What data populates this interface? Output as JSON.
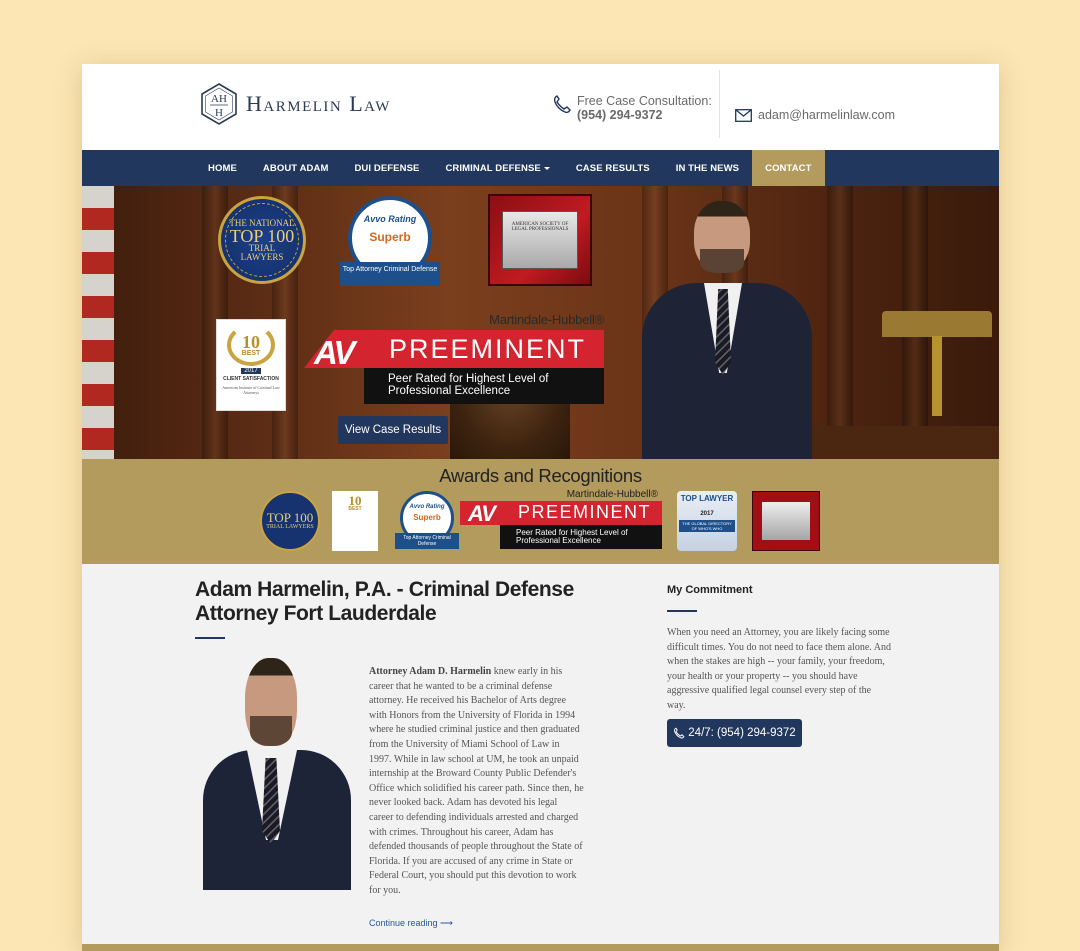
{
  "header": {
    "logo_text": "Harmelin Law",
    "logo_monogram": "AH",
    "consult_label": "Free Case Consultation:",
    "consult_phone": "(954) 294-9372",
    "email": "adam@harmelinlaw.com",
    "icons": [
      "phone-icon",
      "envelope-icon"
    ]
  },
  "nav": {
    "items": [
      {
        "label": "HOME"
      },
      {
        "label": "ABOUT ADAM"
      },
      {
        "label": "DUI DEFENSE"
      },
      {
        "label": "CRIMINAL DEFENSE"
      },
      {
        "label": "CASE RESULTS"
      },
      {
        "label": "IN THE NEWS"
      },
      {
        "label": "CONTACT"
      }
    ],
    "active": "CONTACT",
    "colors": {
      "bar": "#22375e",
      "active": "#b39a5d"
    }
  },
  "hero": {
    "top100": {
      "l1": "THE NATIONAL",
      "big": "TOP 100",
      "l2": "TRIAL",
      "l3": "LAWYERS"
    },
    "avvo": {
      "rating": "Avvo Rating",
      "grade": "Superb",
      "ribbon": "Top Attorney Criminal Defense"
    },
    "plaque": {
      "text": "AMERICAN SOCIETY OF LEGAL PROFESSIONALS"
    },
    "tenbest": {
      "num": "10",
      "best": "BEST",
      "year": "2017",
      "label": "CLIENT SATISFACTION",
      "org": "American Institute of Criminal Law Attorneys"
    },
    "av": {
      "brand": "Martindale-Hubbell®",
      "letters": "AV",
      "word": "PREEMINENT",
      "sub": "Peer Rated for Highest Level of Professional Excellence"
    },
    "button": "View Case Results"
  },
  "awards": {
    "title": "Awards and Recognitions",
    "top100": {
      "big": "TOP 100",
      "sm": "TRIAL LAWYERS"
    },
    "tenbest": {
      "num": "10",
      "best": "BEST"
    },
    "avvo": {
      "rating": "Avvo Rating",
      "grade": "Superb",
      "ribbon": "Top Attorney Criminal Defense"
    },
    "av": {
      "brand": "Martindale-Hubbell®",
      "letters": "AV",
      "word": "PREEMINENT",
      "sub": "Peer Rated for Highest Level of Professional Excellence"
    },
    "toplawyer": {
      "title": "TOP LAWYER",
      "year": "2017",
      "dir": "THE GLOBAL DIRECTORY OF WHO'S WHO"
    }
  },
  "content": {
    "title": "Adam Harmelin, P.A. - Criminal Defense Attorney Fort Lauderdale",
    "bio_lead": "Attorney Adam D. Harmelin",
    "bio": " knew early in his career that he wanted to be a criminal defense attorney. He received his Bachelor of Arts degree with Honors from the University of Florida in 1994 where he studied criminal justice and then graduated from the University of Miami School of Law in 1997. While in law school at UM, he took an unpaid internship at the Broward County Public Defender's Office which solidified his career path. Since then, he never looked back. Adam has devoted his legal career to defending individuals arrested and charged with crimes. Throughout his career, Adam has defended thousands of people throughout the State of Florida. If you are accused of any crime in State or Federal Court, you should put this devotion to work for you.",
    "continue": "Continue reading ⟶"
  },
  "sidebar": {
    "title": "My Commitment",
    "text": "When you need an Attorney, you are likely facing some difficult times. You do not need to face them alone. And when the stakes are high -- your family, your freedom, your health or your property -- you should have aggressive qualified legal counsel every step of the way.",
    "call_button": "24/7: (954) 294-9372"
  }
}
